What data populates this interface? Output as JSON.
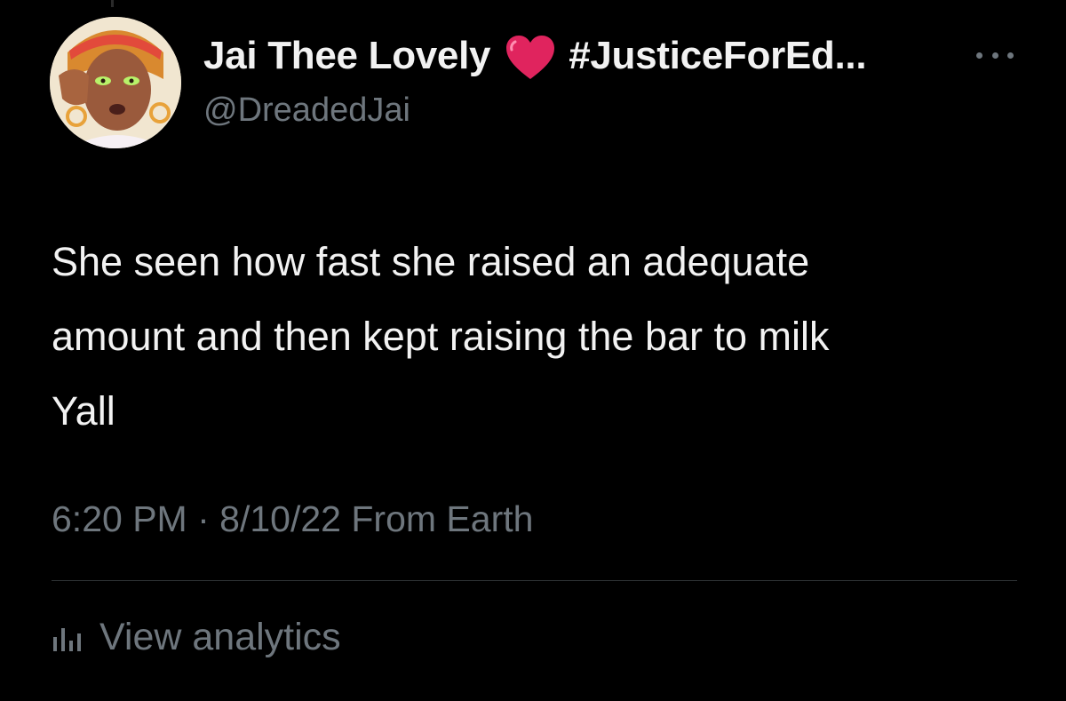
{
  "tweet": {
    "author": {
      "display_name": "Jai Thee Lovely",
      "emoji": "heart-icon",
      "hashtag": "#JusticeForEd...",
      "handle": "@DreadedJai"
    },
    "text_lines": [
      "She seen how fast she raised an adequate",
      "amount and then kept raising the bar to milk",
      "Yall"
    ],
    "time": "6:20 PM",
    "separator": "·",
    "date": "8/10/22",
    "source": "From Earth",
    "analytics_label": "View analytics"
  },
  "colors": {
    "background": "#000000",
    "primary_text": "#f2f2f2",
    "secondary_text": "#6e767d",
    "heart": "#e0245e",
    "divider": "#2f3336"
  }
}
